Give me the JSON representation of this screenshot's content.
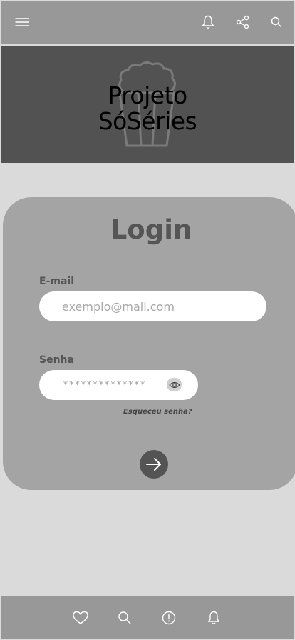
{
  "app": {
    "title_line1": "Projeto",
    "title_line2": "SóSéries"
  },
  "topbar": {
    "icons": [
      "menu-icon",
      "bell-icon",
      "share-icon",
      "search-icon"
    ]
  },
  "login": {
    "title": "Login",
    "email_label": "E-mail",
    "email_placeholder": "exemplo@mail.com",
    "password_label": "Senha",
    "password_value": "**************",
    "forgot_label": "Esqueceu senha?"
  },
  "bottombar": {
    "icons": [
      "heart-icon",
      "search-icon",
      "alert-icon",
      "bell-icon"
    ]
  },
  "colors": {
    "bars": "#989898",
    "hero": "#525252",
    "card": "#a4a4a4",
    "background": "#dadada",
    "submit": "#545454"
  }
}
